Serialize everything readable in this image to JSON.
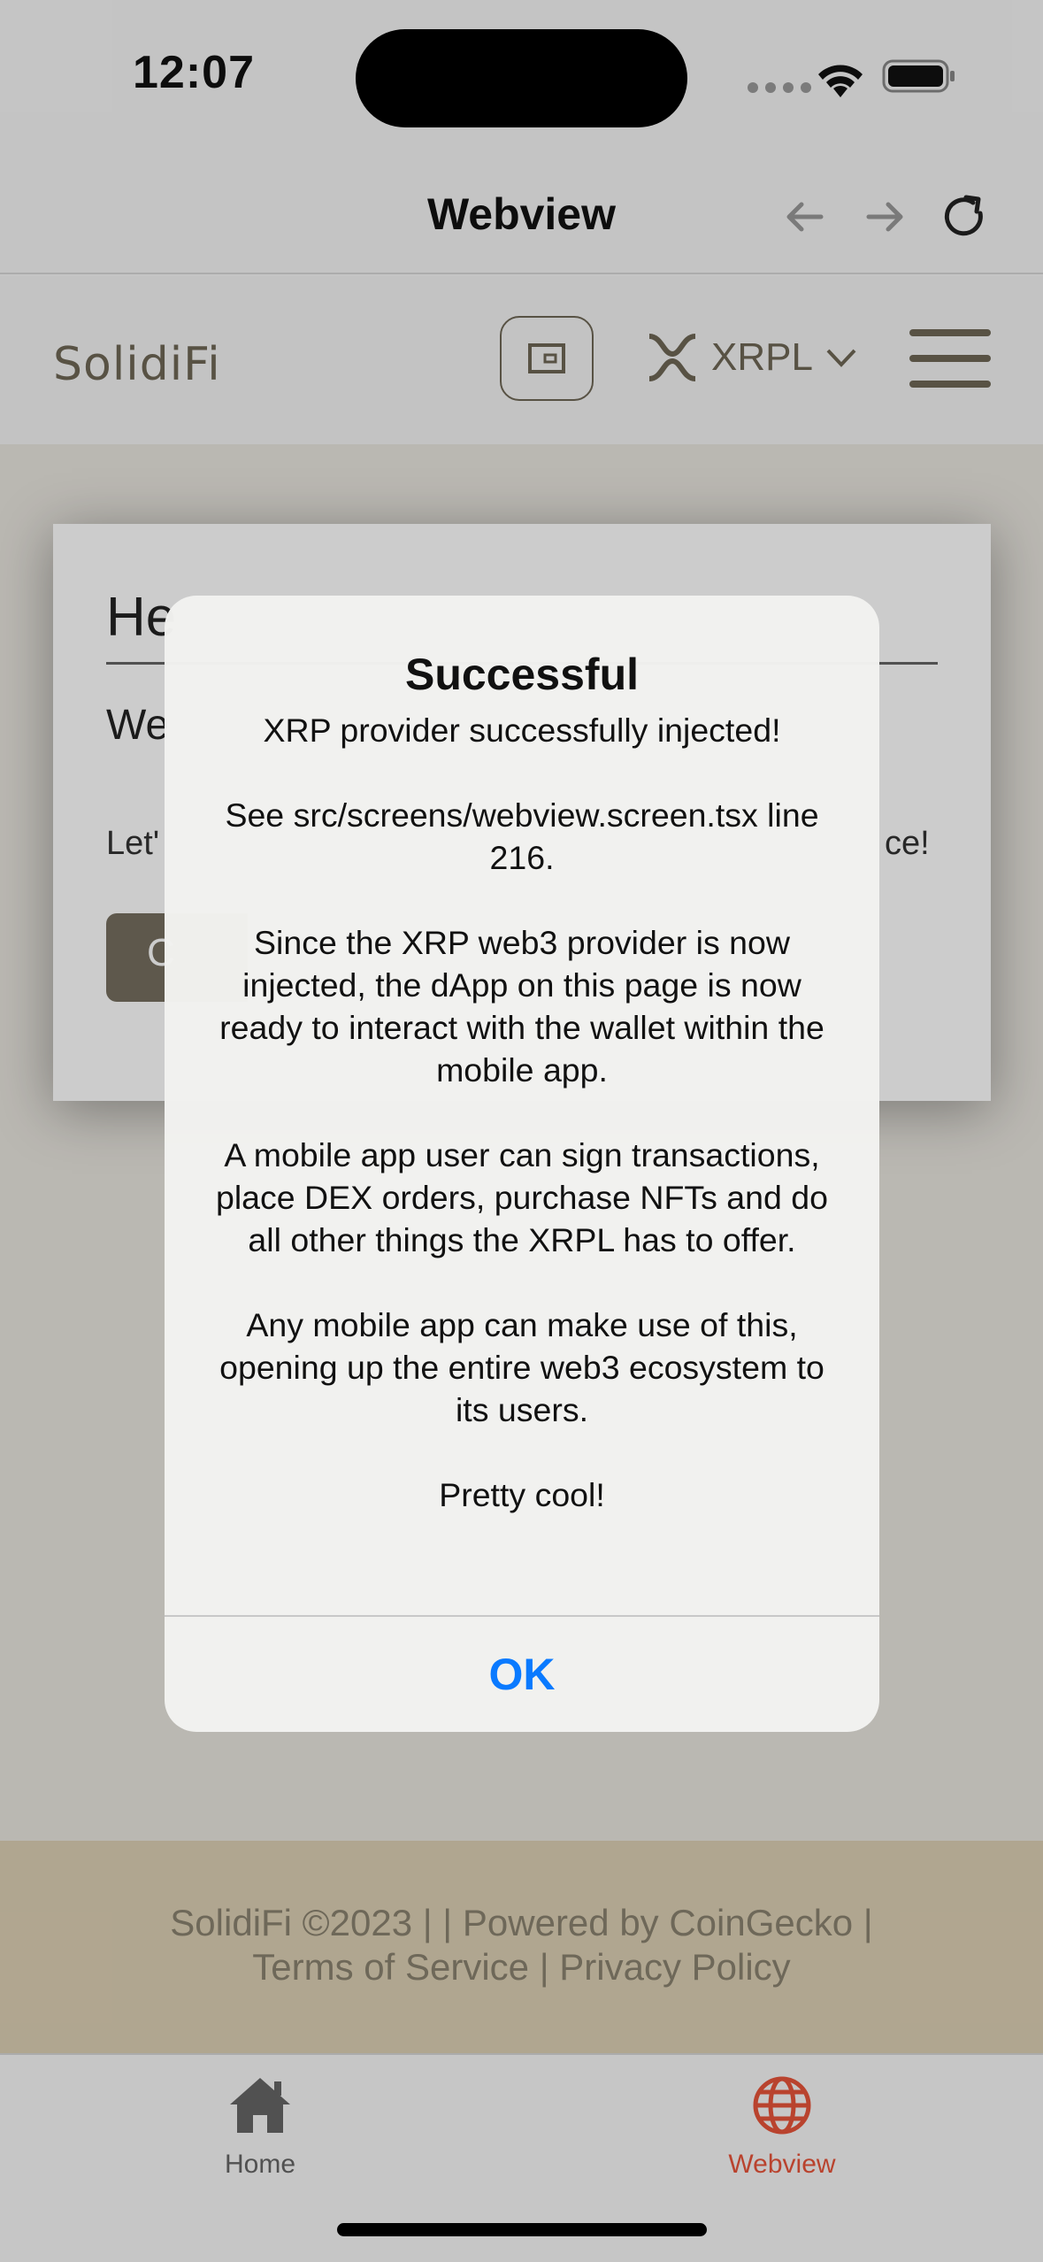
{
  "status_bar": {
    "time": "12:07",
    "icons": [
      "signal-dots-icon",
      "wifi-icon",
      "battery-icon"
    ]
  },
  "nav_header": {
    "title": "Webview",
    "icons": [
      "back-arrow-icon",
      "forward-arrow-icon",
      "reload-icon"
    ]
  },
  "site": {
    "logo": "SolidiFi",
    "network": "XRPL",
    "hero": {
      "title_partial": "He",
      "subtitle_partial": "We",
      "text_start": "Let'",
      "text_end": "ce!",
      "button_partial": "C"
    },
    "footer": {
      "line1": "SolidiFi ©2023 | | Powered by CoinGecko |",
      "line2": "Terms of Service | Privacy Policy"
    }
  },
  "alert": {
    "title": "Successful",
    "paragraphs": [
      "XRP provider successfully injected!",
      "See src/screens/webview.screen.tsx line 216.",
      "Since the XRP web3 provider is now injected, the dApp on this page is now ready to interact with the wallet within the mobile app.",
      "A mobile app user can sign transactions, place DEX orders, purchase NFTs and do all other things the XRPL has to offer.",
      "Any mobile app can make use of this, opening up the entire web3 ecosystem to its users.",
      "Pretty cool!"
    ],
    "ok_label": "OK"
  },
  "tab_bar": {
    "tabs": [
      {
        "label": "Home",
        "icon": "home-icon",
        "active": false
      },
      {
        "label": "Webview",
        "icon": "globe-icon",
        "active": true
      }
    ]
  },
  "colors": {
    "brand": "#6e6756",
    "footer_bg": "#ddd0b4",
    "active_tab": "#e8543a",
    "inactive_tab": "#666666",
    "alert_button": "#0a7aff"
  }
}
